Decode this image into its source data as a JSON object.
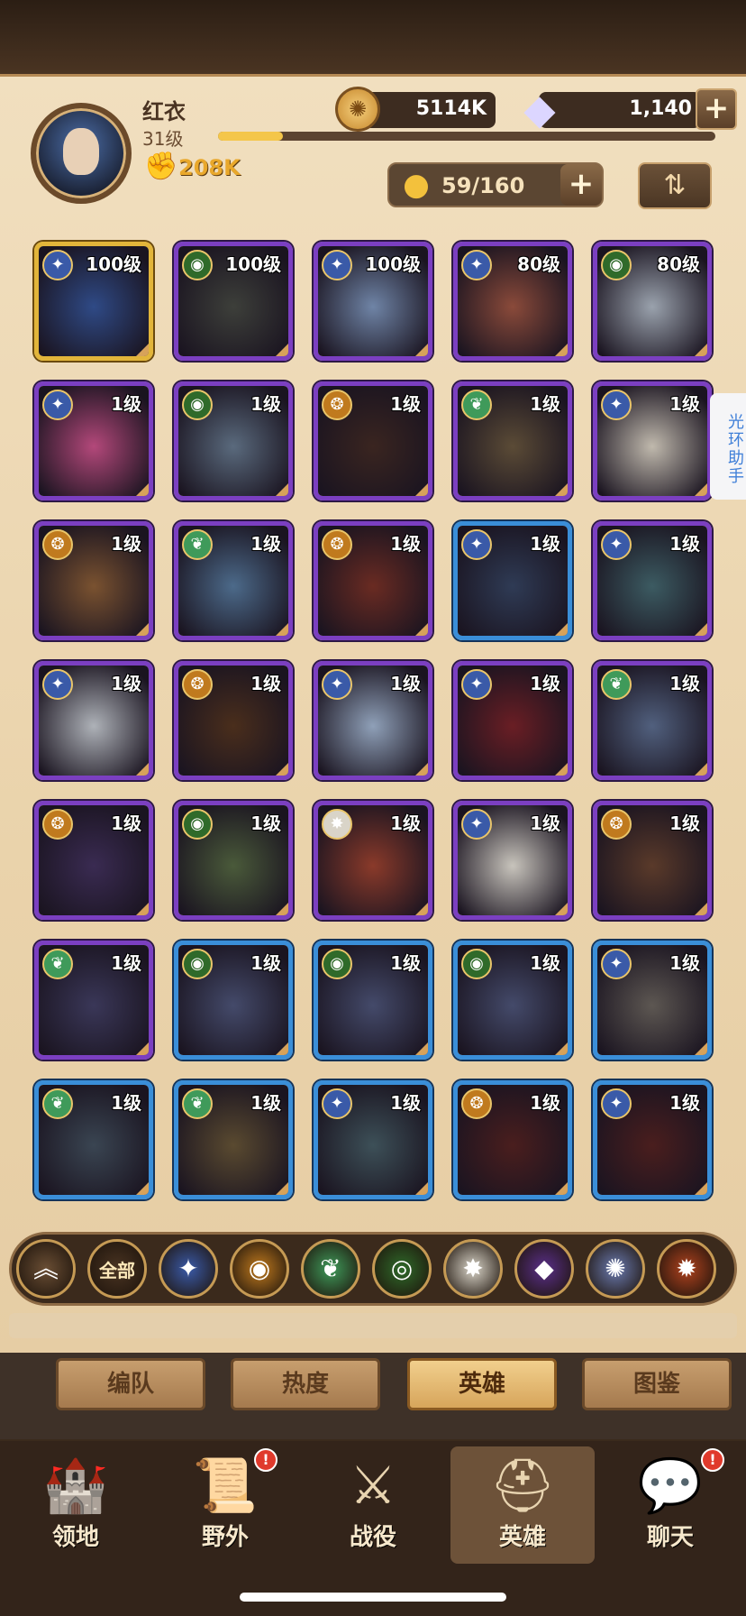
{
  "player": {
    "name": "红衣",
    "level": "31级",
    "power": "208K",
    "xp_fraction": 0.13
  },
  "currency": {
    "gold": "5114K",
    "gems": "1,140",
    "add_label": "+"
  },
  "roster": {
    "count": "59/160",
    "add_label": "+"
  },
  "icons": {
    "gold": "gold-coin-icon",
    "gem": "diamond-icon",
    "power": "fist-icon",
    "hero_count": "person-icon",
    "sort": "sort-icon"
  },
  "side_helper": {
    "label": "光环助手"
  },
  "heroes": [
    {
      "level": "100级",
      "frame": "gold",
      "faction": "lightbearer",
      "art": "#2f4a86"
    },
    {
      "level": "100级",
      "frame": "purple",
      "faction": "wilder",
      "art": "#3d3f3a"
    },
    {
      "level": "100级",
      "frame": "purple",
      "faction": "lightbearer",
      "art": "#6f84a6"
    },
    {
      "level": "80级",
      "frame": "purple",
      "faction": "lightbearer",
      "art": "#8a4a3a"
    },
    {
      "level": "80级",
      "frame": "purple",
      "faction": "wilder",
      "art": "#9aa2ad"
    },
    {
      "level": "1级",
      "frame": "purple",
      "faction": "lightbearer",
      "art": "#b3487a"
    },
    {
      "level": "1级",
      "frame": "purple",
      "faction": "wilder",
      "art": "#5a6a7d"
    },
    {
      "level": "1级",
      "frame": "purple",
      "faction": "mauler",
      "art": "#3a2520"
    },
    {
      "level": "1级",
      "frame": "purple",
      "faction": "graveborn",
      "art": "#5b4b36"
    },
    {
      "level": "1级",
      "frame": "purple",
      "faction": "lightbearer",
      "art": "#c0b9ad"
    },
    {
      "level": "1级",
      "frame": "purple",
      "faction": "mauler",
      "art": "#7a5230"
    },
    {
      "level": "1级",
      "frame": "purple",
      "faction": "graveborn",
      "art": "#4c6a8a"
    },
    {
      "level": "1级",
      "frame": "purple",
      "faction": "mauler",
      "art": "#6a2b22"
    },
    {
      "level": "1级",
      "frame": "blue",
      "faction": "lightbearer",
      "art": "#2f3b55"
    },
    {
      "level": "1级",
      "frame": "purple",
      "faction": "lightbearer",
      "art": "#3c5b62"
    },
    {
      "level": "1级",
      "frame": "purple",
      "faction": "lightbearer",
      "art": "#aeb2b8"
    },
    {
      "level": "1级",
      "frame": "purple",
      "faction": "mauler",
      "art": "#4a2e1c"
    },
    {
      "level": "1级",
      "frame": "purple",
      "faction": "lightbearer",
      "art": "#8fa0b8"
    },
    {
      "level": "1级",
      "frame": "purple",
      "faction": "lightbearer",
      "art": "#6a1e24"
    },
    {
      "level": "1级",
      "frame": "purple",
      "faction": "graveborn",
      "art": "#51607e"
    },
    {
      "level": "1级",
      "frame": "purple",
      "faction": "mauler",
      "art": "#3a2b52"
    },
    {
      "level": "1级",
      "frame": "purple",
      "faction": "wilder",
      "art": "#4a5a3a"
    },
    {
      "level": "1级",
      "frame": "purple",
      "faction": "celestial",
      "art": "#8a3a2a"
    },
    {
      "level": "1级",
      "frame": "purple",
      "faction": "lightbearer",
      "art": "#c8c4bc"
    },
    {
      "level": "1级",
      "frame": "purple",
      "faction": "mauler",
      "art": "#5a3a2a"
    },
    {
      "level": "1级",
      "frame": "purple",
      "faction": "graveborn",
      "art": "#3a3758"
    },
    {
      "level": "1级",
      "frame": "blue",
      "faction": "wilder",
      "art": "#444a6a"
    },
    {
      "level": "1级",
      "frame": "blue",
      "faction": "wilder",
      "art": "#444a6a"
    },
    {
      "level": "1级",
      "frame": "blue",
      "faction": "wilder",
      "art": "#444a6a"
    },
    {
      "level": "1级",
      "frame": "blue",
      "faction": "lightbearer",
      "art": "#5d5752"
    },
    {
      "level": "1级",
      "frame": "blue",
      "faction": "graveborn",
      "art": "#3a4552"
    },
    {
      "level": "1级",
      "frame": "blue",
      "faction": "graveborn",
      "art": "#5a4a30"
    },
    {
      "level": "1级",
      "frame": "blue",
      "faction": "lightbearer",
      "art": "#3d5058"
    },
    {
      "level": "1级",
      "frame": "blue",
      "faction": "mauler",
      "art": "#4a1e1e"
    },
    {
      "level": "1级",
      "frame": "blue",
      "faction": "lightbearer",
      "art": "#4a1e1e"
    }
  ],
  "faction_colors": {
    "lightbearer": "#3a5aa8",
    "wilder": "#2f6a2a",
    "mauler": "#c07a1e",
    "graveborn": "#3f9a5a",
    "celestial": "#d9d4c8"
  },
  "filters": [
    {
      "name": "collapse",
      "label": "︽",
      "color": "#6a4e34"
    },
    {
      "name": "all",
      "label": "全部",
      "color": "#4a3422"
    },
    {
      "name": "lightbearer",
      "label": "✦",
      "color": "#3a5aa8"
    },
    {
      "name": "mauler",
      "label": "◉",
      "color": "#c07a1e"
    },
    {
      "name": "graveborn",
      "label": "❦",
      "color": "#3f9a5a"
    },
    {
      "name": "wilder",
      "label": "◎",
      "color": "#2f6a2a"
    },
    {
      "name": "celestial",
      "label": "✸",
      "color": "#d9d4c8"
    },
    {
      "name": "hypogean",
      "label": "◆",
      "color": "#5a2f8a"
    },
    {
      "name": "dimensional",
      "label": "✺",
      "color": "#6a7ab0"
    },
    {
      "name": "draconis",
      "label": "✹",
      "color": "#b0421e"
    }
  ],
  "subtabs": [
    "编队",
    "热度",
    "英雄",
    "图鉴"
  ],
  "nav": [
    {
      "label": "领地",
      "icon": "castle-icon",
      "glyph": "🏰",
      "badge": ""
    },
    {
      "label": "野外",
      "icon": "scroll-map-icon",
      "glyph": "📜",
      "badge": "!"
    },
    {
      "label": "战役",
      "icon": "sword-crest-icon",
      "glyph": "⚔",
      "badge": ""
    },
    {
      "label": "英雄",
      "icon": "helmet-icon",
      "glyph": "⛑",
      "badge": ""
    },
    {
      "label": "聊天",
      "icon": "chat-bubble-icon",
      "glyph": "💬",
      "badge": "!"
    }
  ]
}
